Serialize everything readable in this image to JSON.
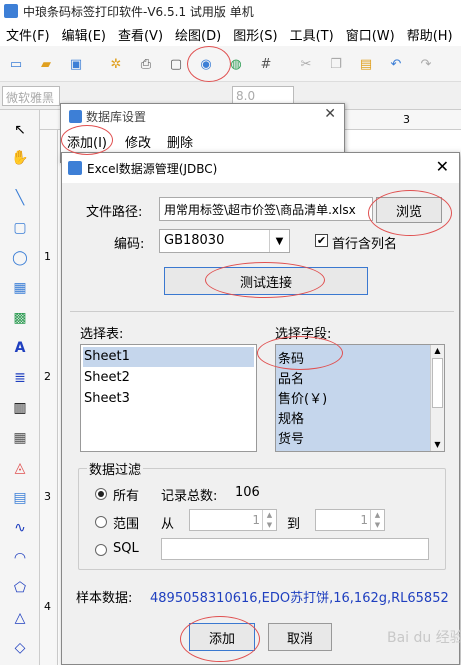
{
  "app": {
    "title": "中琅条码标签打印软件-V6.5.1 试用版 单机"
  },
  "menu": [
    "文件(F)",
    "编辑(E)",
    "查看(V)",
    "绘图(D)",
    "图形(S)",
    "工具(T)",
    "窗口(W)",
    "帮助(H)"
  ],
  "font": {
    "name": "微软雅黑",
    "size": "8.0"
  },
  "ruler": {
    "h": "3",
    "v": [
      "1",
      "2",
      "3",
      "4"
    ]
  },
  "db_dialog": {
    "title": "数据库设置",
    "menu": [
      "添加(I)",
      "修改",
      "删除"
    ]
  },
  "excel_dialog": {
    "title": "Excel数据源管理(JDBC)",
    "path_label": "文件路径:",
    "path_value": "用常用标签\\超市价签\\商品清单.xlsx",
    "browse_label": "浏览",
    "encoding_label": "编码:",
    "encoding_value": "GB18030",
    "header_row_label": "首行含列名",
    "header_row_checked": true,
    "test_label": "测试连接",
    "select_table_label": "选择表:",
    "tables": [
      "Sheet1",
      "Sheet2",
      "Sheet3"
    ],
    "select_field_label": "选择字段:",
    "fields": [
      "条码",
      "品名",
      "售价(￥)",
      "规格",
      "货号"
    ],
    "filter": {
      "title": "数据过滤",
      "all_label": "所有",
      "total_label": "记录总数:",
      "total_value": "106",
      "range_label": "范围",
      "from_label": "从",
      "from_value": "1",
      "to_label": "到",
      "to_value": "1",
      "sql_label": "SQL"
    },
    "sample_label": "样本数据:",
    "sample_value": "4895058310616,EDO苏打饼,16,162g,RL65852",
    "add_label": "添加",
    "cancel_label": "取消"
  },
  "watermark": "Bai du 经验",
  "colors": {
    "accent": "#3d7fd6",
    "annotation": "#e05050",
    "selection": "#c5d6ec",
    "sample_text": "#1f3fbf"
  }
}
